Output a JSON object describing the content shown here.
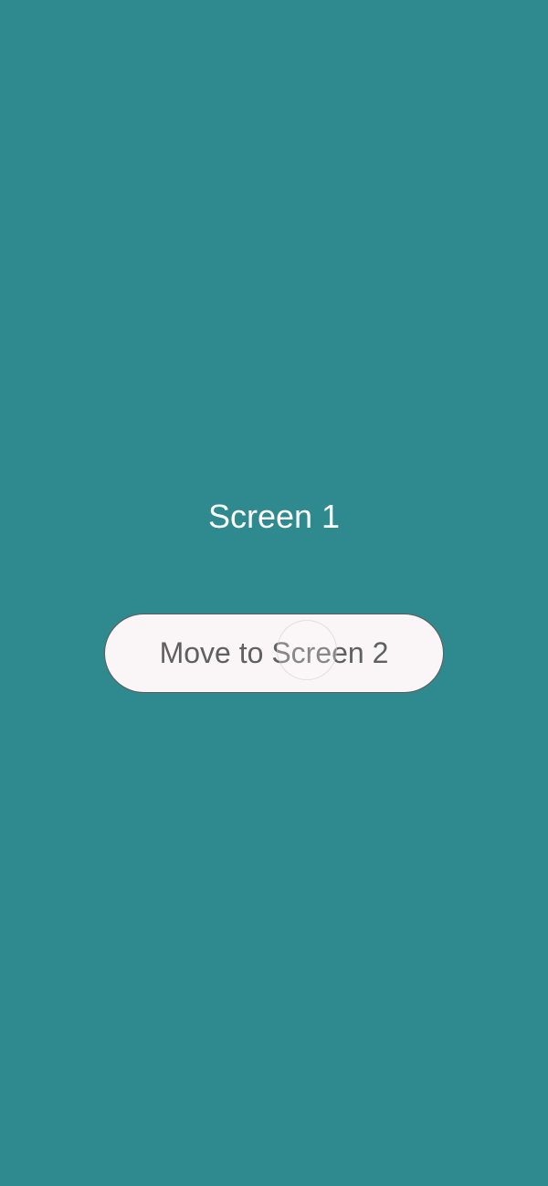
{
  "screen": {
    "title": "Screen 1",
    "button_label": "Move to Screen 2"
  },
  "colors": {
    "background": "#2e8a8f",
    "button_bg": "#faf5f7",
    "button_text": "#606060",
    "title_text": "#ffffff"
  }
}
